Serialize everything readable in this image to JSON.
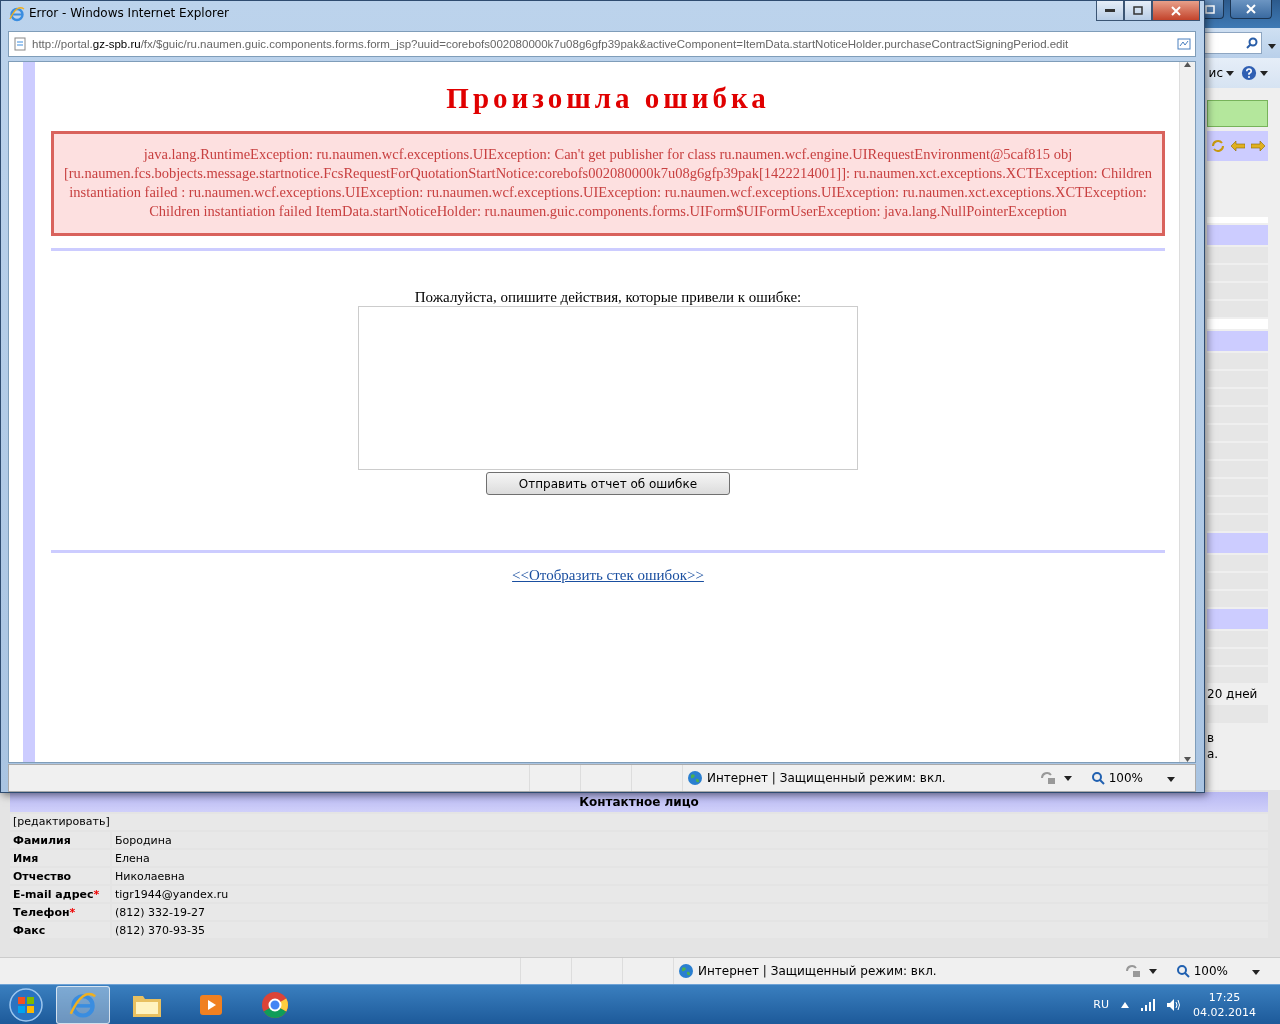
{
  "background_window": {
    "command_bar_partial": "ис",
    "side_texts": [
      "20 дней",
      "в",
      "а."
    ],
    "contact": {
      "title": "Контактное лицо",
      "edit_link": "[редактировать]",
      "rows": [
        {
          "label": "Фамилия",
          "value": "Бородина"
        },
        {
          "label": "Имя",
          "value": "Елена"
        },
        {
          "label": "Отчество",
          "value": "Николаевна"
        },
        {
          "label": "E-mail адрес",
          "marker": "*",
          "value": "tigr1944@yandex.ru"
        },
        {
          "label": "Телефон",
          "marker": "*",
          "value": "(812) 332-19-27"
        },
        {
          "label": "Факс",
          "value": "(812) 370-93-35"
        }
      ]
    },
    "status_bar": {
      "zone": "Интернет | Защищенный режим: вкл.",
      "zoom": "100%"
    }
  },
  "popup_window": {
    "title": "Error - Windows Internet Explorer",
    "address": "http://portal.**gz-spb.ru**/fx/$guic/ru.naumen.guic.components.forms.form_jsp?uuid=corebofs002080000k7u08g6gfp39pak&activeComponent=ItemData.startNoticeHolder.purchaseContractSigningPeriod.edit",
    "heading": "Произошла ошибка",
    "error_text": "java.lang.RuntimeException: ru.naumen.wcf.exceptions.UIException: Can't get publisher for class ru.naumen.wcf.engine.UIRequestEnvironment@5caf815 obj [ru.naumen.fcs.bobjects.message.startnotice.FcsRequestForQuotationStartNotice:corebofs002080000k7u08g6gfp39pak[1422214001]]: ru.naumen.xct.exceptions.XCTException: Children instantiation failed : ru.naumen.wcf.exceptions.UIException: ru.naumen.wcf.exceptions.UIException: ru.naumen.wcf.exceptions.UIException: ru.naumen.xct.exceptions.XCTException: Children instantiation failed ItemData.startNoticeHolder: ru.naumen.guic.components.forms.UIForm$UIFormUserException: java.lang.NullPointerException",
    "prompt": "Пожалуйста, опишите действия, которые привели к ошибке:",
    "send_button": "Отправить отчет об ошибке",
    "stack_link": "<<Отобразить стек ошибок>>",
    "status_bar": {
      "zone": "Интернет | Защищенный режим: вкл.",
      "zoom": "100%"
    }
  },
  "taskbar": {
    "apps": [
      {
        "kind": "ie",
        "active": true
      },
      {
        "kind": "folder",
        "active": false
      },
      {
        "kind": "media",
        "active": false
      },
      {
        "kind": "chrome",
        "active": false
      }
    ],
    "language": "RU",
    "time": "17:25",
    "date": "04.02.2014"
  }
}
